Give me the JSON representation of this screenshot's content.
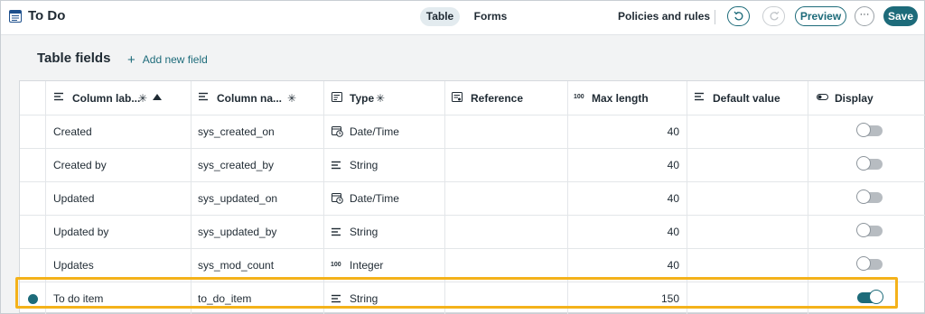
{
  "header": {
    "title": "To Do",
    "tabs": [
      {
        "label": "Table",
        "active": true
      },
      {
        "label": "Forms",
        "active": false
      }
    ],
    "policies_label": "Policies and rules",
    "preview_label": "Preview",
    "more_label": "···",
    "save_label": "Save"
  },
  "section": {
    "title": "Table fields",
    "add_label": "Add new field"
  },
  "columns": [
    {
      "label": "Column lab...",
      "icon": "text-lines-icon",
      "required": true,
      "sorted": "asc"
    },
    {
      "label": "Column na...",
      "icon": "text-lines-icon",
      "required": true
    },
    {
      "label": "Type",
      "icon": "type-list-icon",
      "required": true
    },
    {
      "label": "Reference",
      "icon": "reference-list-icon"
    },
    {
      "label": "Max length",
      "icon": "numeric-100-icon"
    },
    {
      "label": "Default value",
      "icon": "text-lines-icon"
    },
    {
      "label": "Display",
      "icon": "toggle-icon"
    }
  ],
  "rows": [
    {
      "label": "Created",
      "name": "sys_created_on",
      "type": "Date/Time",
      "type_icon": "calendar-clock-icon",
      "reference": "",
      "max_length": "40",
      "default_value": "",
      "display": false,
      "selected": false
    },
    {
      "label": "Created by",
      "name": "sys_created_by",
      "type": "String",
      "type_icon": "text-lines-icon",
      "reference": "",
      "max_length": "40",
      "default_value": "",
      "display": false,
      "selected": false
    },
    {
      "label": "Updated",
      "name": "sys_updated_on",
      "type": "Date/Time",
      "type_icon": "calendar-clock-icon",
      "reference": "",
      "max_length": "40",
      "default_value": "",
      "display": false,
      "selected": false
    },
    {
      "label": "Updated by",
      "name": "sys_updated_by",
      "type": "String",
      "type_icon": "text-lines-icon",
      "reference": "",
      "max_length": "40",
      "default_value": "",
      "display": false,
      "selected": false
    },
    {
      "label": "Updates",
      "name": "sys_mod_count",
      "type": "Integer",
      "type_icon": "numeric-100-icon",
      "reference": "",
      "max_length": "40",
      "default_value": "",
      "display": false,
      "selected": false
    },
    {
      "label": "To do item",
      "name": "to_do_item",
      "type": "String",
      "type_icon": "text-lines-icon",
      "reference": "",
      "max_length": "150",
      "default_value": "",
      "display": true,
      "selected": true
    }
  ],
  "colors": {
    "accent": "#1d6b7a",
    "highlight": "#f4b21a",
    "background": "#f2f3f4"
  }
}
